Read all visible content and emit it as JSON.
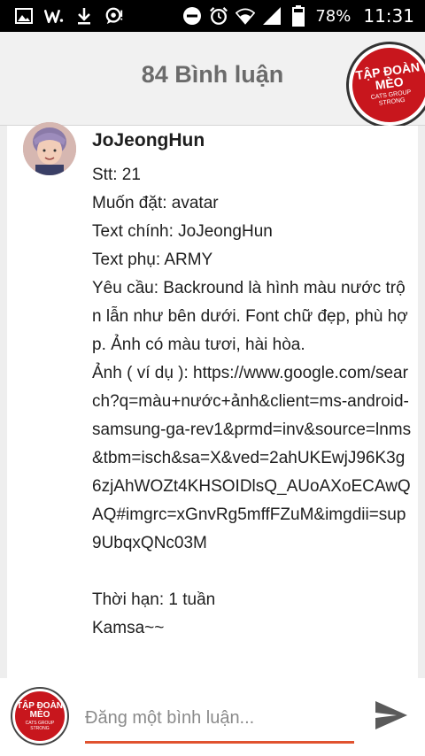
{
  "status_bar": {
    "battery": "78%",
    "time": "11:31"
  },
  "header": {
    "title": "84 Bình luận",
    "logo": {
      "line1": "TẬP ĐOÀN",
      "line2": "MÈO",
      "line3": "CATS GROUP",
      "line4": "STRONG"
    }
  },
  "comment": {
    "author": "JoJeongHun",
    "text": "Stt: 21\nMuốn đặt: avatar\nText chính: JoJeongHun\nText phụ: ARMY\nYêu cầu: Backround là hình màu nước trộn lẫn như bên dưới. Font chữ đẹp, phù hợp. Ảnh có màu tươi, hài hòa.\nẢnh ( ví dụ ): https://www.google.com/search?q=màu+nước+ảnh&client=ms-android-samsung-ga-rev1&prmd=inv&source=lnms&tbm=isch&sa=X&ved=2ahUKEwjJ96K3g6zjAhWOZt4KHSOIDlsQ_AUoAXoECAwQAQ#imgrc=xGnvRg5mffFZuM&imgdii=sup9UbqxQNc03M\n\nThời hạn: 1 tuần\nKamsa~~"
  },
  "composer": {
    "placeholder": "Đăng một bình luận..."
  },
  "colors": {
    "accent": "#e0522f",
    "brand_red": "#c8161d",
    "header_bg": "#f1f1f1",
    "status_bar_bg": "#000000"
  },
  "icons": {
    "status_left": [
      "image-icon",
      "w-icon",
      "download-icon",
      "chat-icon"
    ],
    "status_right": [
      "minus-circle-icon",
      "alarm-icon",
      "wifi-icon",
      "signal-icon",
      "battery-icon"
    ],
    "send": "send-icon"
  }
}
